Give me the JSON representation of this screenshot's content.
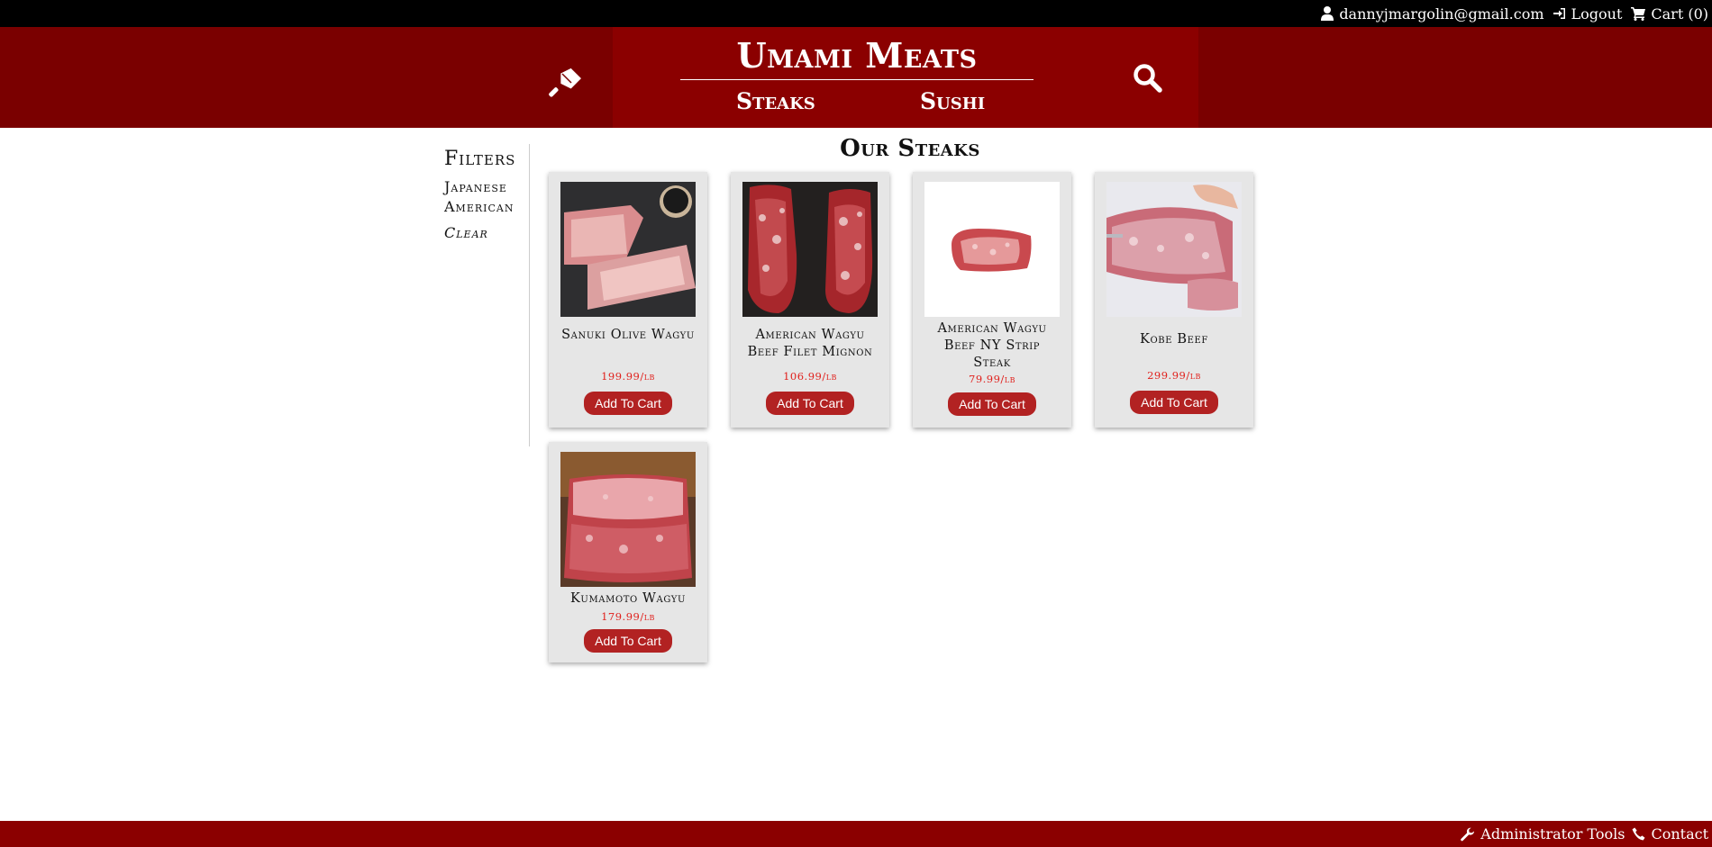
{
  "topbar": {
    "user_icon": "user-icon",
    "user_email": "dannyjmargolin@gmail.com",
    "logout_icon": "sign-out-icon",
    "logout_label": "Logout",
    "cart_icon": "cart-icon",
    "cart_label": "Cart (0)"
  },
  "header": {
    "logo_icon": "cleaver-icon",
    "brand": "Umami Meats",
    "search_icon": "search-icon",
    "nav": [
      "Steaks",
      "Sushi"
    ]
  },
  "filters": {
    "title": "Filters",
    "items": [
      "Japanese",
      "American"
    ],
    "clear": "Clear"
  },
  "main": {
    "title": "Our Steaks",
    "products": [
      {
        "name": "Sanuki Olive Wagyu",
        "price": "199.99/lb",
        "button": "Add To Cart"
      },
      {
        "name": "American Wagyu Beef Filet Mignon",
        "price": "106.99/lb",
        "button": "Add To Cart"
      },
      {
        "name": "American Wagyu Beef NY Strip Steak",
        "price": "79.99/lb",
        "button": "Add To Cart"
      },
      {
        "name": "Kobe Beef",
        "price": "299.99/lb",
        "button": "Add To Cart"
      },
      {
        "name": "Kumamoto Wagyu",
        "price": "179.99/lb",
        "button": "Add To Cart"
      }
    ]
  },
  "footer": {
    "admin_icon": "wrench-icon",
    "admin_label": "Administrator Tools",
    "contact_icon": "phone-icon",
    "contact_label": "Contact"
  },
  "colors": {
    "topbar": "#000000",
    "header": "#7a0000",
    "header_center": "#8b0000",
    "button": "#b22222",
    "price": "#e0201c",
    "footer": "#8b0000"
  }
}
